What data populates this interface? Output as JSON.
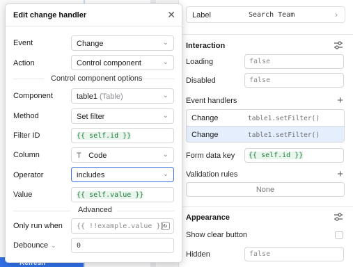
{
  "background": {
    "bottom_button_label": "Refresh"
  },
  "inspector": {
    "label_row": {
      "key": "Label",
      "value": "Search Team"
    },
    "interaction": {
      "title": "Interaction",
      "loading_label": "Loading",
      "loading_value": "false",
      "disabled_label": "Disabled",
      "disabled_value": "false",
      "event_handlers_label": "Event handlers",
      "handlers": [
        {
          "event": "Change",
          "action": "table1.setFilter()"
        },
        {
          "event": "Change",
          "action": "table1.setFilter()"
        }
      ],
      "form_data_key_label": "Form data key",
      "form_data_key_value": "{{ self.id }}",
      "validation_rules_label": "Validation rules",
      "validation_rules_value": "None"
    },
    "appearance": {
      "title": "Appearance",
      "show_clear_button_label": "Show clear button",
      "hidden_label": "Hidden",
      "hidden_value": "false"
    }
  },
  "modal": {
    "title": "Edit change handler",
    "event_label": "Event",
    "event_value": "Change",
    "action_label": "Action",
    "action_value": "Control component",
    "options_heading": "Control component options",
    "component_label": "Component",
    "component_value": "table1",
    "component_type": "(Table)",
    "method_label": "Method",
    "method_value": "Set filter",
    "filter_id_label": "Filter ID",
    "filter_id_value": "{{ self.id }}",
    "column_label": "Column",
    "column_value": "Code",
    "operator_label": "Operator",
    "operator_value": "includes",
    "value_label": "Value",
    "value_value": "{{ self.value }}",
    "advanced_heading": "Advanced",
    "only_run_when_label": "Only run when",
    "only_run_when_placeholder": "{{ !!example.value }}",
    "debounce_label": "Debounce",
    "debounce_value": "0"
  }
}
